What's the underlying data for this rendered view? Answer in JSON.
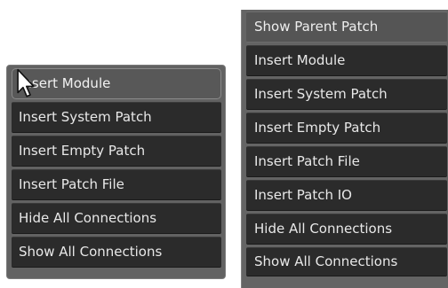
{
  "left_menu": {
    "items": [
      {
        "label": "Insert Module"
      },
      {
        "label": "Insert System Patch"
      },
      {
        "label": "Insert Empty Patch"
      },
      {
        "label": "Insert Patch File"
      },
      {
        "label": "Hide All Connections"
      },
      {
        "label": "Show All Connections"
      }
    ]
  },
  "right_menu": {
    "items": [
      {
        "label": "Show Parent Patch"
      },
      {
        "label": "Insert Module"
      },
      {
        "label": "Insert System Patch"
      },
      {
        "label": "Insert Empty Patch"
      },
      {
        "label": "Insert Patch File"
      },
      {
        "label": "Insert Patch IO"
      },
      {
        "label": "Hide All Connections"
      },
      {
        "label": "Show All Connections"
      }
    ]
  },
  "cursor": {
    "icon": "arrow-cursor-icon"
  }
}
